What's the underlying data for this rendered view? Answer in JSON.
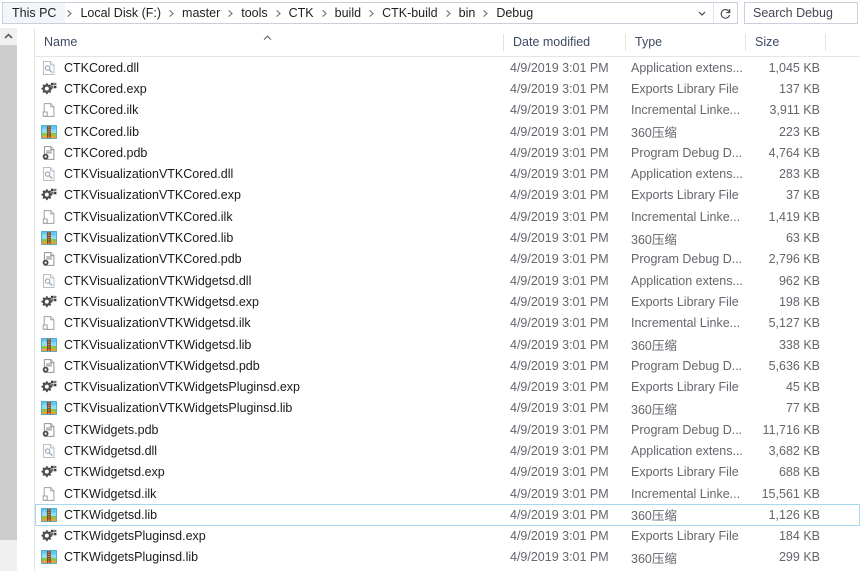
{
  "window": {
    "app": "file-explorer"
  },
  "addressbar": {
    "breadcrumbs": [
      {
        "label": "This PC"
      },
      {
        "label": "Local Disk (F:)"
      },
      {
        "label": "master"
      },
      {
        "label": "tools"
      },
      {
        "label": "CTK"
      },
      {
        "label": "build"
      },
      {
        "label": "CTK-build"
      },
      {
        "label": "bin"
      },
      {
        "label": "Debug"
      }
    ],
    "dropdown_icon": "chevron-down-icon",
    "refresh_icon": "refresh-icon"
  },
  "search": {
    "placeholder": "Search Debug",
    "value": ""
  },
  "columns": {
    "name": "Name",
    "date_modified": "Date modified",
    "type": "Type",
    "size": "Size",
    "sort_column": "Name",
    "sort_direction": "ascending"
  },
  "colors": {
    "selection_border": "#a8d8f0",
    "header_text": "#3c4b63",
    "secondary_text": "#63666b",
    "scrollbar_thumb": "#cdcdcd"
  },
  "files": [
    {
      "name": "CTKCored.dll",
      "icon": "dll-file-icon",
      "date": "4/9/2019 3:01 PM",
      "type": "Application extens...",
      "size": "1,045 KB",
      "selected": false
    },
    {
      "name": "CTKCored.exp",
      "icon": "exp-file-icon",
      "date": "4/9/2019 3:01 PM",
      "type": "Exports Library File",
      "size": "137 KB",
      "selected": false
    },
    {
      "name": "CTKCored.ilk",
      "icon": "ilk-file-icon",
      "date": "4/9/2019 3:01 PM",
      "type": "Incremental Linke...",
      "size": "3,911 KB",
      "selected": false
    },
    {
      "name": "CTKCored.lib",
      "icon": "archive-360zip-icon",
      "date": "4/9/2019 3:01 PM",
      "type": "360压缩",
      "size": "223 KB",
      "selected": false
    },
    {
      "name": "CTKCored.pdb",
      "icon": "pdb-file-icon",
      "date": "4/9/2019 3:01 PM",
      "type": "Program Debug D...",
      "size": "4,764 KB",
      "selected": false
    },
    {
      "name": "CTKVisualizationVTKCored.dll",
      "icon": "dll-file-icon",
      "date": "4/9/2019 3:01 PM",
      "type": "Application extens...",
      "size": "283 KB",
      "selected": false
    },
    {
      "name": "CTKVisualizationVTKCored.exp",
      "icon": "exp-file-icon",
      "date": "4/9/2019 3:01 PM",
      "type": "Exports Library File",
      "size": "37 KB",
      "selected": false
    },
    {
      "name": "CTKVisualizationVTKCored.ilk",
      "icon": "ilk-file-icon",
      "date": "4/9/2019 3:01 PM",
      "type": "Incremental Linke...",
      "size": "1,419 KB",
      "selected": false
    },
    {
      "name": "CTKVisualizationVTKCored.lib",
      "icon": "archive-360zip-icon",
      "date": "4/9/2019 3:01 PM",
      "type": "360压缩",
      "size": "63 KB",
      "selected": false
    },
    {
      "name": "CTKVisualizationVTKCored.pdb",
      "icon": "pdb-file-icon",
      "date": "4/9/2019 3:01 PM",
      "type": "Program Debug D...",
      "size": "2,796 KB",
      "selected": false
    },
    {
      "name": "CTKVisualizationVTKWidgetsd.dll",
      "icon": "dll-file-icon",
      "date": "4/9/2019 3:01 PM",
      "type": "Application extens...",
      "size": "962 KB",
      "selected": false
    },
    {
      "name": "CTKVisualizationVTKWidgetsd.exp",
      "icon": "exp-file-icon",
      "date": "4/9/2019 3:01 PM",
      "type": "Exports Library File",
      "size": "198 KB",
      "selected": false
    },
    {
      "name": "CTKVisualizationVTKWidgetsd.ilk",
      "icon": "ilk-file-icon",
      "date": "4/9/2019 3:01 PM",
      "type": "Incremental Linke...",
      "size": "5,127 KB",
      "selected": false
    },
    {
      "name": "CTKVisualizationVTKWidgetsd.lib",
      "icon": "archive-360zip-icon",
      "date": "4/9/2019 3:01 PM",
      "type": "360压缩",
      "size": "338 KB",
      "selected": false
    },
    {
      "name": "CTKVisualizationVTKWidgetsd.pdb",
      "icon": "pdb-file-icon",
      "date": "4/9/2019 3:01 PM",
      "type": "Program Debug D...",
      "size": "5,636 KB",
      "selected": false
    },
    {
      "name": "CTKVisualizationVTKWidgetsPluginsd.exp",
      "icon": "exp-file-icon",
      "date": "4/9/2019 3:01 PM",
      "type": "Exports Library File",
      "size": "45 KB",
      "selected": false
    },
    {
      "name": "CTKVisualizationVTKWidgetsPluginsd.lib",
      "icon": "archive-360zip-icon",
      "date": "4/9/2019 3:01 PM",
      "type": "360压缩",
      "size": "77 KB",
      "selected": false
    },
    {
      "name": "CTKWidgets.pdb",
      "icon": "pdb-file-icon",
      "date": "4/9/2019 3:01 PM",
      "type": "Program Debug D...",
      "size": "11,716 KB",
      "selected": false
    },
    {
      "name": "CTKWidgetsd.dll",
      "icon": "dll-file-icon",
      "date": "4/9/2019 3:01 PM",
      "type": "Application extens...",
      "size": "3,682 KB",
      "selected": false
    },
    {
      "name": "CTKWidgetsd.exp",
      "icon": "exp-file-icon",
      "date": "4/9/2019 3:01 PM",
      "type": "Exports Library File",
      "size": "688 KB",
      "selected": false
    },
    {
      "name": "CTKWidgetsd.ilk",
      "icon": "ilk-file-icon",
      "date": "4/9/2019 3:01 PM",
      "type": "Incremental Linke...",
      "size": "15,561 KB",
      "selected": false
    },
    {
      "name": "CTKWidgetsd.lib",
      "icon": "archive-360zip-icon",
      "date": "4/9/2019 3:01 PM",
      "type": "360压缩",
      "size": "1,126 KB",
      "selected": true
    },
    {
      "name": "CTKWidgetsPluginsd.exp",
      "icon": "exp-file-icon",
      "date": "4/9/2019 3:01 PM",
      "type": "Exports Library File",
      "size": "184 KB",
      "selected": false
    },
    {
      "name": "CTKWidgetsPluginsd.lib",
      "icon": "archive-360zip-icon",
      "date": "4/9/2019 3:01 PM",
      "type": "360压缩",
      "size": "299 KB",
      "selected": false
    }
  ]
}
